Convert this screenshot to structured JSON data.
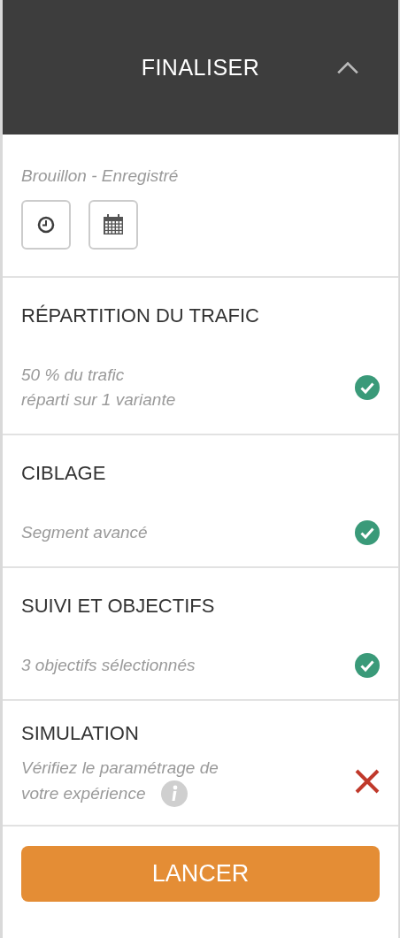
{
  "header": {
    "title": "FINALISER",
    "expanded": true
  },
  "draft": {
    "status": "Brouillon - Enregistré",
    "buttons": [
      {
        "kind": "clock"
      },
      {
        "kind": "calendar"
      }
    ]
  },
  "sections": [
    {
      "title": "RÉPARTITION DU TRAFIC",
      "summary": [
        "50 % du trafic",
        "réparti sur 1 variante"
      ],
      "valid": true,
      "info": false
    },
    {
      "title": "CIBLAGE",
      "summary": [
        "Segment avancé"
      ],
      "valid": true,
      "info": false
    },
    {
      "title": "SUIVI ET OBJECTIFS",
      "summary": [
        "3 objectifs sélectionnés"
      ],
      "valid": true,
      "info": false
    },
    {
      "title": "SIMULATION",
      "summary": [
        "Vérifiez le paramétrage de",
        "votre expérience"
      ],
      "valid": false,
      "info": true
    }
  ],
  "launch_button": {
    "label": "LANCER"
  }
}
